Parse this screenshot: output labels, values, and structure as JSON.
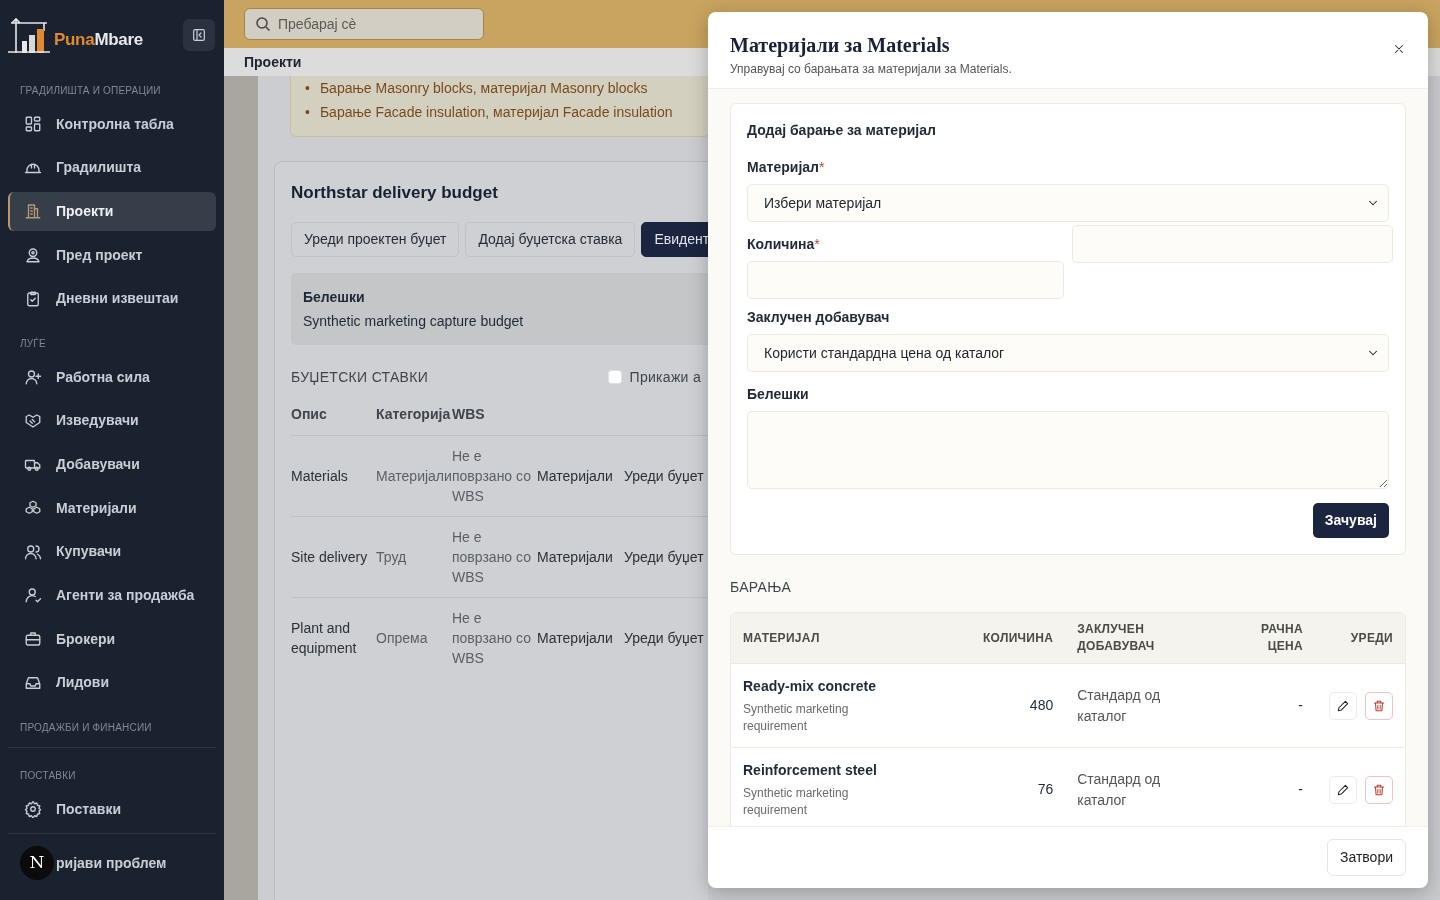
{
  "sidebar": {
    "brand": {
      "first": "Puna",
      "second": "Mbare"
    },
    "sections": [
      {
        "title": "ГРАДИЛИШТА И ОПЕРАЦИИ",
        "items": [
          {
            "label": "Контролна табла",
            "selected": false
          },
          {
            "label": "Градилишта",
            "selected": false
          },
          {
            "label": "Проекти",
            "selected": true
          },
          {
            "label": "Пред проект",
            "selected": false
          },
          {
            "label": "Дневни извештаи",
            "selected": false
          }
        ]
      },
      {
        "title": "ЛУЃЕ",
        "items": [
          {
            "label": "Работна сила",
            "selected": false
          },
          {
            "label": "Изведувачи",
            "selected": false
          },
          {
            "label": "Добавувачи",
            "selected": false
          },
          {
            "label": "Материјали",
            "selected": false
          },
          {
            "label": "Купувачи",
            "selected": false
          },
          {
            "label": "Агенти за продажба",
            "selected": false
          },
          {
            "label": "Брокери",
            "selected": false
          },
          {
            "label": "Лидови",
            "selected": false
          }
        ]
      },
      {
        "title": "ПРОДАЖБИ И ФИНАНСИИ"
      },
      {
        "title": "ПОСТАВКИ",
        "items": [
          {
            "label": "Поставки",
            "selected": false
          }
        ]
      }
    ],
    "report": {
      "avatar": "N",
      "label": "ријави проблем"
    }
  },
  "topbar": {
    "search": {
      "placeholder": "Пребарај сè"
    }
  },
  "breadcrumb": "Проекти",
  "alert": {
    "items": [
      {
        "marker": "•",
        "text": "Барање Masonry blocks, материјал Masonry blocks"
      },
      {
        "marker": "•",
        "text": "Барање Facade insulation, материјал Facade insulation"
      }
    ]
  },
  "budget": {
    "title": "Northstar delivery budget",
    "buttons": [
      {
        "label": "Уреди проектен буџет",
        "kind": "outline"
      },
      {
        "label": "Додај буџетска ставка",
        "kind": "outline"
      },
      {
        "label": "Евидент",
        "kind": "primary"
      }
    ],
    "notes": {
      "label": "Белешки",
      "text": "Synthetic marketing capture budget"
    },
    "items_title": "БУЏЕТСКИ СТАВКИ",
    "show_archived": {
      "label": "Прикажи а",
      "checked": false
    },
    "table": {
      "columns": [
        "Опис",
        "Категорија",
        "WBS"
      ],
      "rows": [
        {
          "description": "Materials",
          "category": "Материјали",
          "wbs": "Не е поврзано со WBS",
          "column_4": "Материјали",
          "column_5": "Уреди буџет"
        },
        {
          "description": "Site delivery",
          "category": "Труд",
          "wbs": "Не е поврзано со WBS",
          "column_4": "Материјали",
          "column_5": "Уреди буџет"
        },
        {
          "description": "Plant and equipment",
          "category": "Опрема",
          "wbs": "Не е поврзано со WBS",
          "column_4": "Материјали",
          "column_5": "Уреди буџет"
        }
      ]
    }
  },
  "modal": {
    "title": "Материјали за Materials",
    "subtitle": "Управувај со барањата за материјали за Materials.",
    "form": {
      "title": "Додај барање за материјал",
      "material": {
        "label": "Материјал",
        "required_mark": "*",
        "value": "Избери материјал"
      },
      "quantity": {
        "label": "Количина",
        "required_mark": "*"
      },
      "supplier": {
        "label": "Заклучен добавувач",
        "value": "Користи стандардна цена од каталог"
      },
      "notes": {
        "label": "Белешки"
      },
      "save": "Зачувај"
    },
    "requests": {
      "title": "БАРАЊА",
      "columns": [
        "МАТЕРИЈАЛ",
        "КОЛИЧИНА",
        "ЗАКЛУЧЕН ДОБАВУВАЧ",
        "РАЧНА ЦЕНА",
        "УРЕДИ"
      ],
      "rows": [
        {
          "material": "Ready-mix concrete",
          "note": "Synthetic marketing requirement",
          "quantity": "480",
          "supplier": "Стандард од каталог",
          "price": "-"
        },
        {
          "material": "Reinforcement steel",
          "note": "Synthetic marketing requirement",
          "quantity": "76",
          "supplier": "Стандард од каталог",
          "price": "-"
        }
      ]
    },
    "close": "Затвори"
  }
}
